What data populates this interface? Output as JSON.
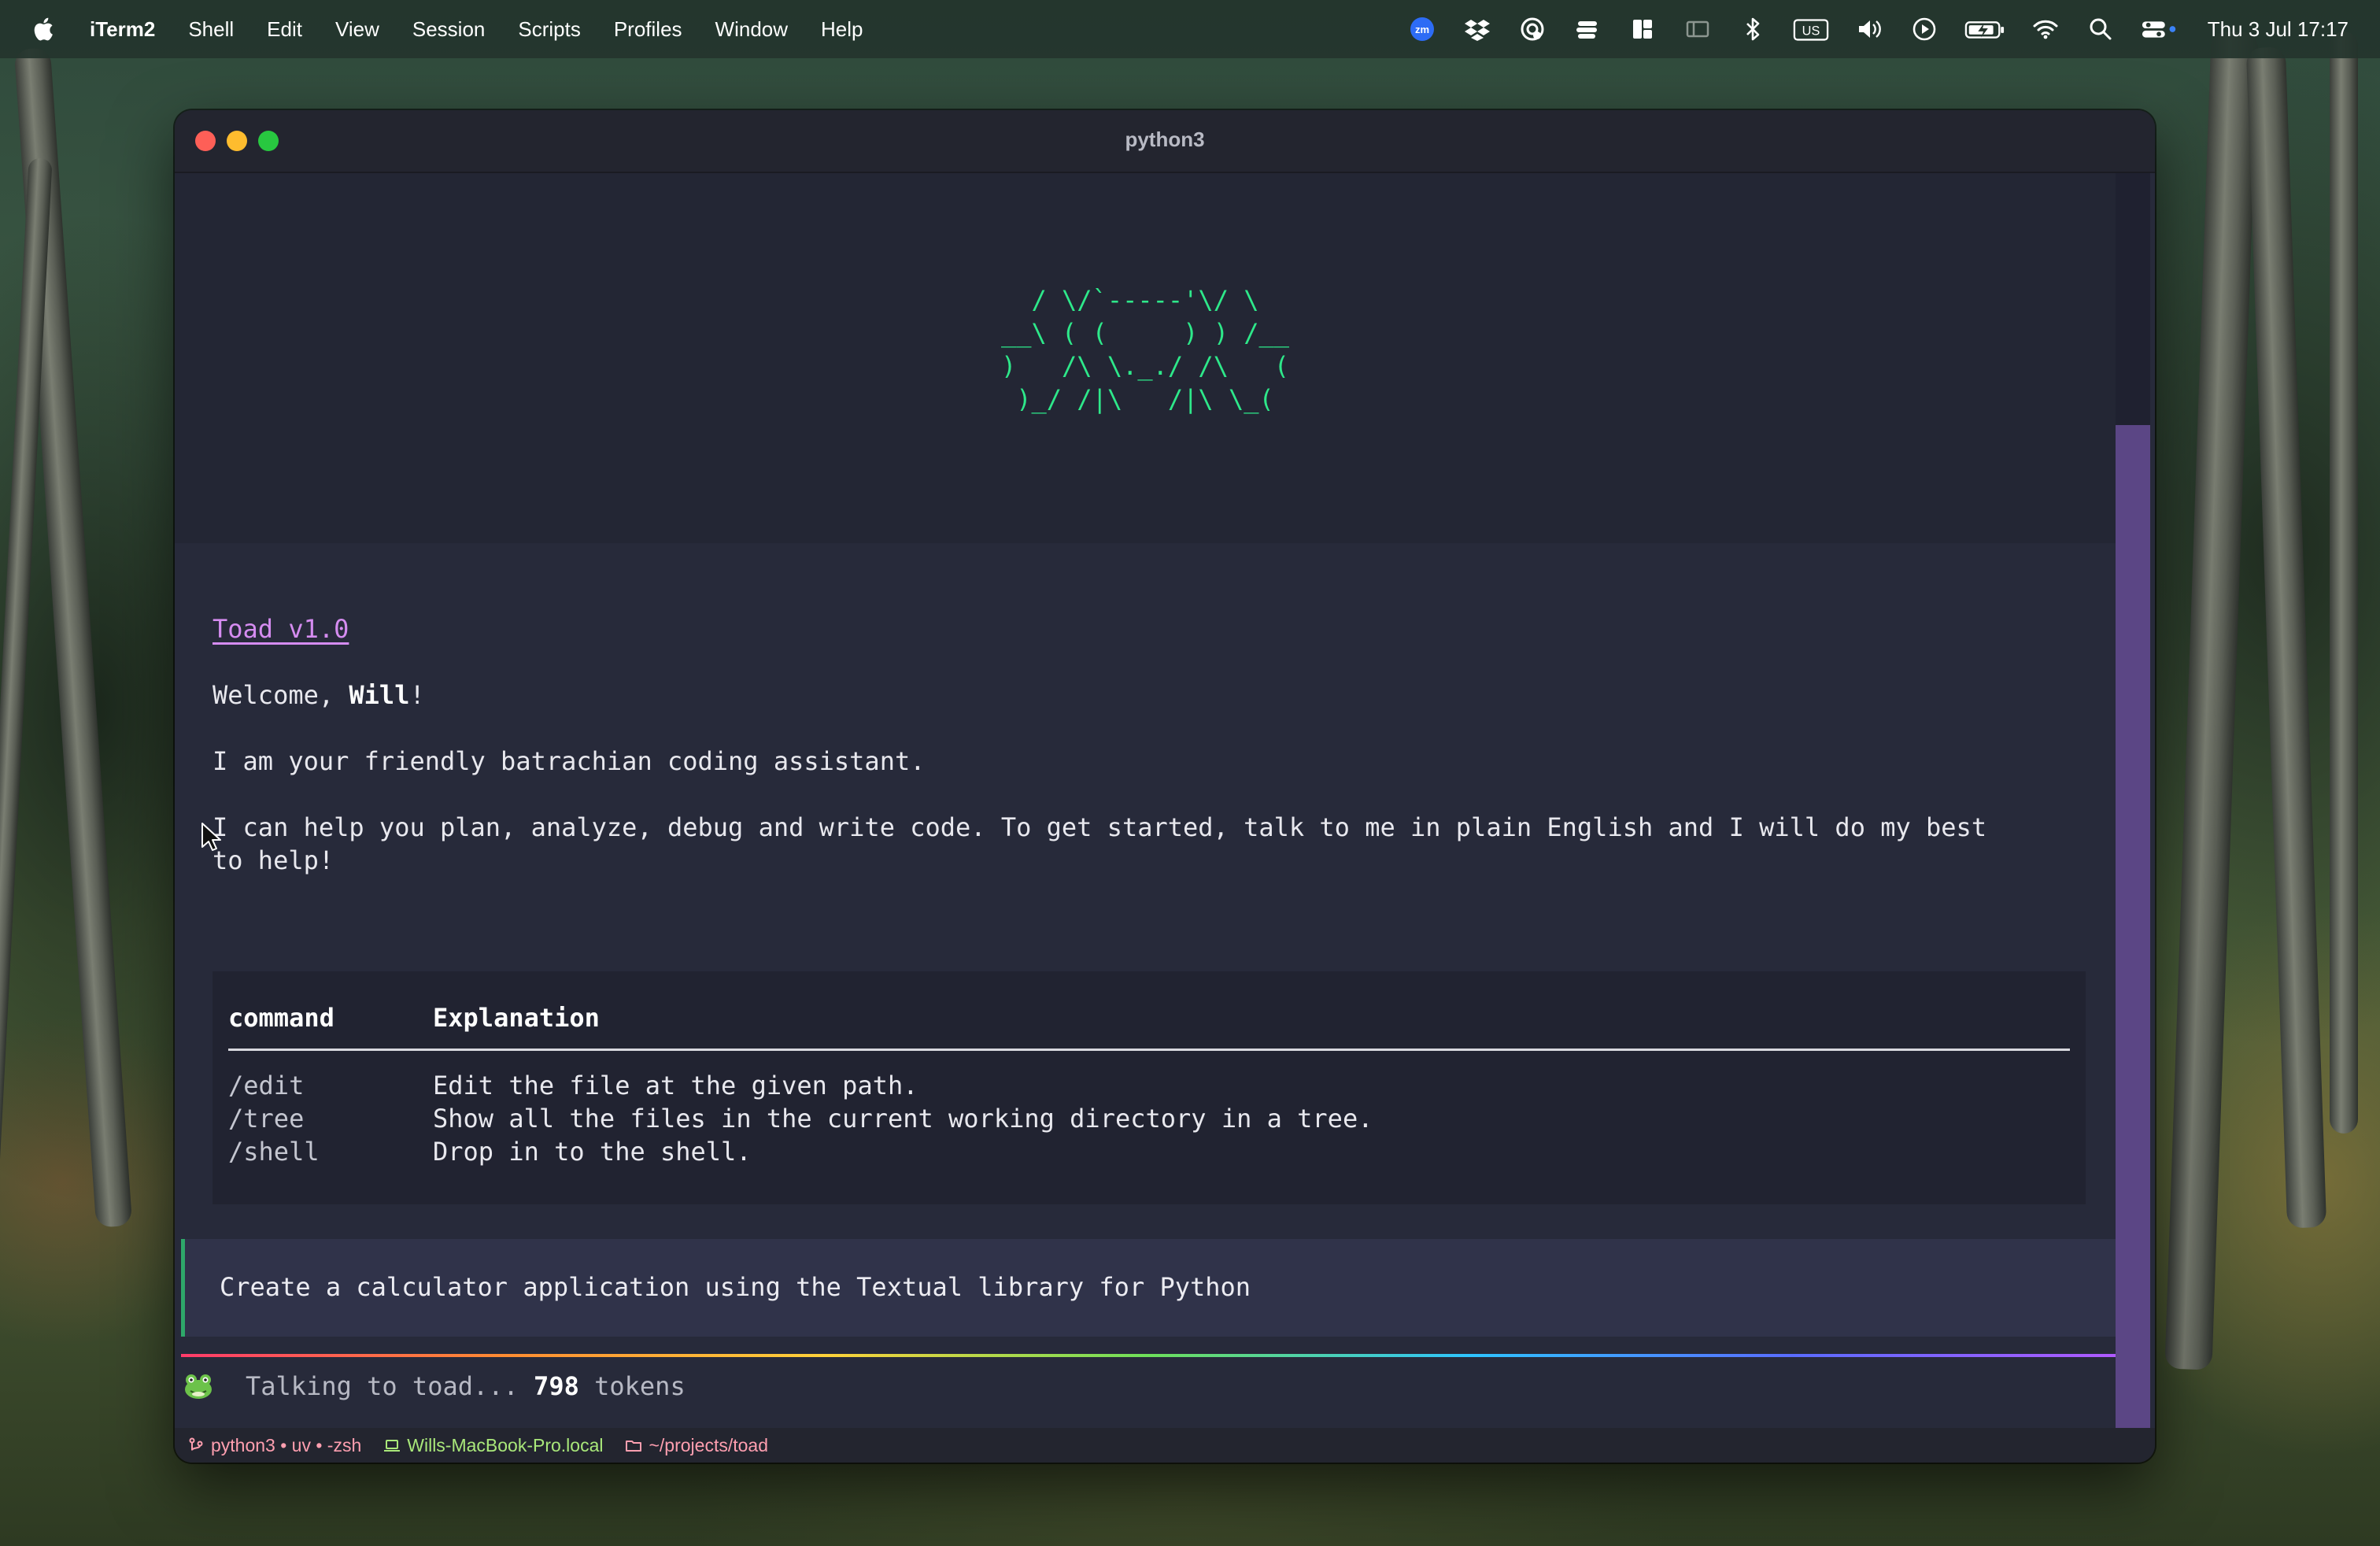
{
  "menubar": {
    "app_name": "iTerm2",
    "items": [
      "Shell",
      "Edit",
      "View",
      "Session",
      "Scripts",
      "Profiles",
      "Window",
      "Help"
    ],
    "tray_icons": [
      "zoom-icon",
      "dropbox-icon",
      "airdrop-icon",
      "stack-icon",
      "split-view-icon",
      "sidebar-icon",
      "bluetooth-icon",
      "input-source-icon",
      "volume-icon",
      "play-icon",
      "battery-icon",
      "wifi-icon",
      "search-icon",
      "control-center-icon"
    ],
    "input_source": "US",
    "zoom_label": "zm",
    "clock": "Thu 3 Jul  17:17"
  },
  "window": {
    "title": "python3"
  },
  "terminal": {
    "ascii_art": [
      "/ \\/`-----'\\/ \\",
      "__\\ ( (     ) ) /__",
      ")   /\\ \\._./ /\\   (",
      " )_/ /|\\   /|\\ \\_( "
    ],
    "app_link": "Toad v1.0",
    "welcome_prefix": "Welcome, ",
    "welcome_name": "Will",
    "welcome_suffix": "!",
    "intro": "I am your friendly batrachian coding assistant.",
    "help_line_1": "I can help you plan, analyze, debug and write code. To get started, talk to me in plain English and I will do my best",
    "help_line_2": "to help!",
    "table": {
      "headers": [
        "command",
        "Explanation"
      ],
      "rows": [
        {
          "command": "/edit",
          "explanation": "Edit the file at the given path."
        },
        {
          "command": "/tree",
          "explanation": "Show all the files in the current working directory in a tree."
        },
        {
          "command": "/shell",
          "explanation": "Drop in to the shell."
        }
      ]
    },
    "user_prompt": "Create a calculator application using the Textual library for Python",
    "status_prefix": "Talking to toad... ",
    "status_count": "798",
    "status_suffix": " tokens",
    "input_value": ""
  },
  "statusbar": {
    "job": "python3 • uv • -zsh",
    "host": "Wills-MacBook-Pro.local",
    "dir": "~/projects/toad"
  },
  "colors": {
    "ascii": "#2ee88a",
    "link": "#d58cf0",
    "input_border": "#c07ae8",
    "scroll_thumb": "#5b4685"
  }
}
